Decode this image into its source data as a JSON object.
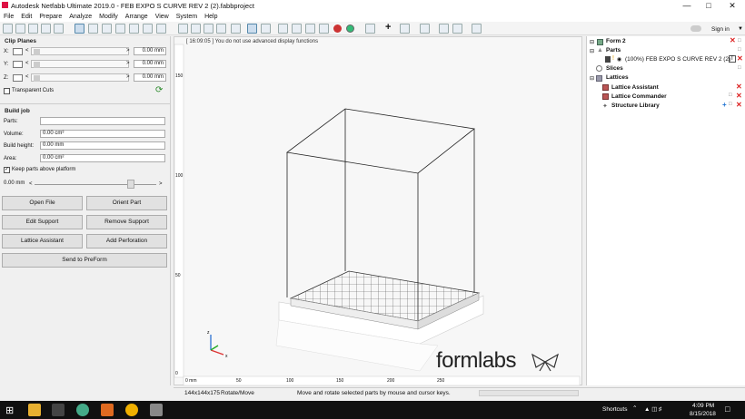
{
  "window": {
    "title": "Autodesk Netfabb Ultimate 2019.0 - FEB EXPO S CURVE REV 2 (2).fabbproject"
  },
  "menu": [
    "File",
    "Edit",
    "Prepare",
    "Analyze",
    "Modify",
    "Arrange",
    "View",
    "System",
    "Help"
  ],
  "signin": "Sign in",
  "clip_planes": {
    "title": "Clip Planes",
    "rows": [
      {
        "axis": "X:",
        "value": "0.00 mm"
      },
      {
        "axis": "Y:",
        "value": "0.00 mm"
      },
      {
        "axis": "Z:",
        "value": "0.00 mm"
      }
    ],
    "transparent_cuts": "Transparent Cuts"
  },
  "build_job": {
    "title": "Build job",
    "fields": [
      {
        "label": "Parts:",
        "value": ""
      },
      {
        "label": "Volume:",
        "value": "0.00 cm³"
      },
      {
        "label": "Build height:",
        "value": "0.00 mm"
      },
      {
        "label": "Area:",
        "value": "0.00 cm²"
      }
    ],
    "keep_above": "Keep parts above platform",
    "offset": "0.00 mm"
  },
  "buttons": {
    "open_file": "Open File",
    "orient_part": "Orient Part",
    "edit_support": "Edit Support",
    "remove_support": "Remove Support",
    "lattice_assistant": "Lattice Assistant",
    "add_perforation": "Add Perforation",
    "send_preform": "Send to PreForm"
  },
  "viewport": {
    "message": "[ 16:09:05 ] You do not use advanced display functions",
    "ruler_x": [
      "0 mm",
      "50",
      "100",
      "150",
      "200",
      "250"
    ],
    "ruler_y": [
      "150",
      "100",
      "50",
      "0"
    ],
    "brand": "formlabs"
  },
  "tree": {
    "root": "Form 2",
    "parts": "Parts",
    "part_item": "(100%) FEB EXPO S CURVE REV 2 (2)",
    "slices": "Slices",
    "lattices": "Lattices",
    "lattice_assistant": "Lattice Assistant",
    "lattice_commander": "Lattice Commander",
    "structure_library": "Structure Library"
  },
  "status": {
    "dims": "144x144x175",
    "mode": "Rotate/Move",
    "hint": "Move and rotate selected parts by mouse and cursor keys."
  },
  "taskbar": {
    "shortcuts": "Shortcuts",
    "time": "4:09 PM",
    "date": "8/15/2018"
  },
  "colors": {
    "accent": "#1e73d2",
    "delete": "#dd2222",
    "taskbar": "#101010"
  }
}
